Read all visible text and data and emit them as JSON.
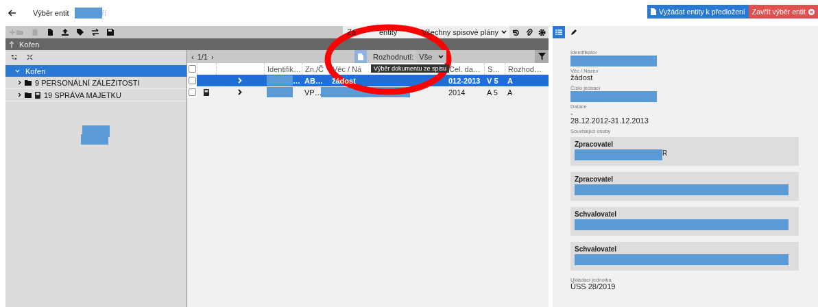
{
  "header": {
    "title": "Výběr entit",
    "title_tail": "ří",
    "buttons": [
      {
        "label": "Vyžádat entity k předložení",
        "kind": "primary"
      },
      {
        "label": "Zavřít výběr entit",
        "kind": "danger"
      }
    ]
  },
  "toolbar": {
    "items": [
      {
        "kind": "add-folder",
        "disabled": true
      },
      {
        "kind": "delete",
        "disabled": true
      },
      {
        "kind": "document",
        "disabled": false
      },
      {
        "kind": "upload",
        "disabled": false
      },
      {
        "kind": "tag",
        "disabled": false
      },
      {
        "kind": "swap",
        "disabled": false
      },
      {
        "kind": "save",
        "disabled": false
      }
    ],
    "filter_label_start": "Zá",
    "filter_label_end": "entity",
    "plan_select": "Všechny spisové plány"
  },
  "breadcrumb": "Kořen",
  "tree": {
    "items": [
      {
        "label": "Kořen",
        "selected": true,
        "expanded": true,
        "children": [
          {
            "label": "9 PERSONÁLNÍ ZÁLEŽITOSTI",
            "selected": false,
            "expanded": false,
            "has_book": false
          },
          {
            "label": "19 SPRÁVA MAJETKU",
            "selected": false,
            "expanded": false,
            "has_book": true
          }
        ]
      }
    ]
  },
  "table": {
    "pager_prev": "‹",
    "pager": "1/1",
    "pager_next": "›",
    "decision_label": "Rozhodnutí:",
    "decision_value": "Vše",
    "tooltip": "Výběr dokumentu ze spisu",
    "all_checked": false,
    "columns": [
      "Identifik…",
      "Zn./Č",
      "Věc / Ná",
      "Cel. da…",
      "S…",
      "Rozhod…"
    ],
    "rows": [
      {
        "selected": true,
        "checked": false,
        "has_book": false,
        "identifier": "…",
        "mark": "AB…",
        "subject": "žádost",
        "dates": "012-2013",
        "storage": "V 5",
        "decision": "A"
      },
      {
        "selected": false,
        "checked": false,
        "has_book": true,
        "mark": "VP…",
        "dates": "2014",
        "storage": "A 5",
        "decision": "A"
      }
    ]
  },
  "detail": {
    "tabs": [
      {
        "kind": "list",
        "selected": true
      },
      {
        "kind": "edit",
        "selected": false
      }
    ],
    "fields": [
      {
        "label": "Identifikátor"
      },
      {
        "label": "Věc / Název",
        "value": "žádost"
      },
      {
        "label": "Číslo jednací"
      },
      {
        "label": "Datace",
        "value": "-\n28.12.2012-31.12.2013"
      }
    ],
    "persons_label": "Související osoby",
    "persons": [
      {
        "role": "Zpracovatel",
        "tail": "R",
        "wide": false
      },
      {
        "role": "Zpracovatel",
        "wide": true
      },
      {
        "role": "Schvalovatel",
        "wide": true
      },
      {
        "role": "Schvalovatel",
        "wide": true
      }
    ],
    "unit_label": "Ukládací jednotka",
    "unit_value": "ÚSS 28/2019"
  }
}
